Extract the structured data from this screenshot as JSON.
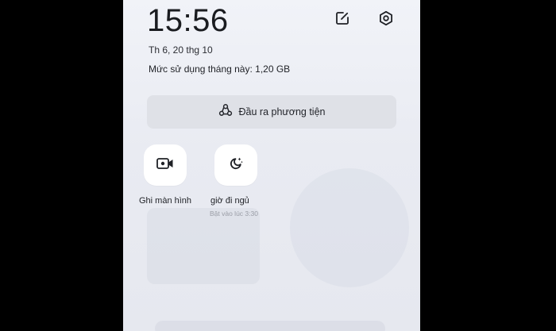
{
  "status": {
    "time": "15:56",
    "date": "Th 6, 20 thg 10",
    "data_usage": "Mức sử dụng tháng này: 1,20 GB"
  },
  "header_icons": {
    "edit": "edit-icon",
    "settings": "gear-icon"
  },
  "media_output": {
    "label": "Đầu ra phương tiện",
    "icon": "media-output-icon"
  },
  "tiles": [
    {
      "label": "Ghi màn hình",
      "icon": "video-camera-icon"
    },
    {
      "label": "giờ đi ngủ",
      "sublabel": "Bật vào lúc 3:30",
      "icon": "moon-stars-icon"
    }
  ],
  "colors": {
    "panel_bg": "#eceef4",
    "tile_bg": "#ffffff",
    "button_bg": "#dfe1e7",
    "text": "#1f2126",
    "muted_text": "#9a9da6"
  }
}
